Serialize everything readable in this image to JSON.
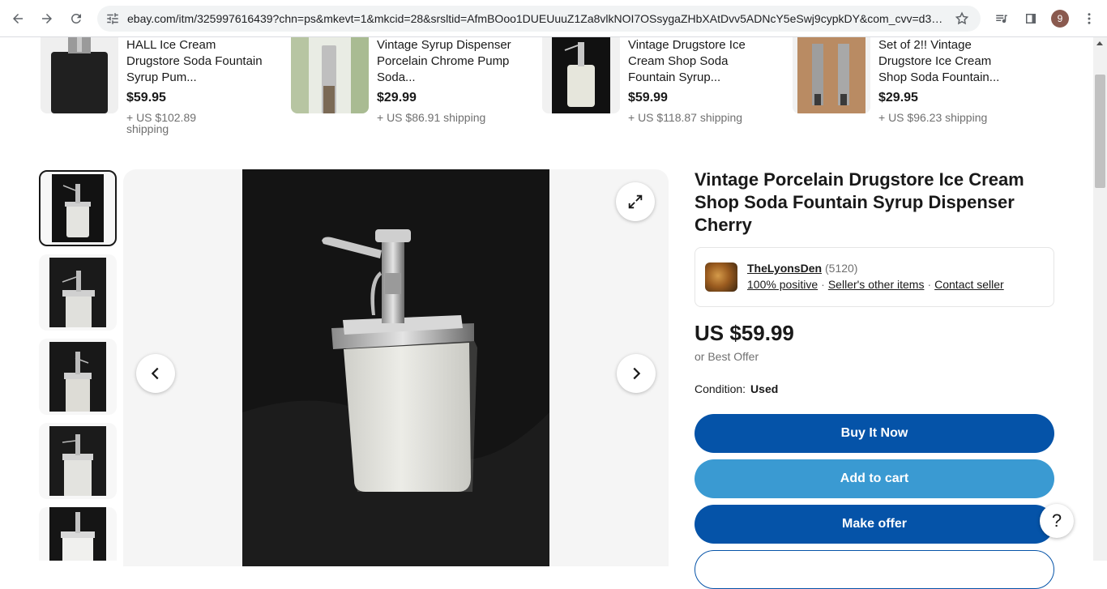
{
  "browser": {
    "url": "ebay.com/itm/325997616439?chn=ps&mkevt=1&mkcid=28&srsltid=AfmBOoo1DUEUuuZ1Za8vlkNOI7OSsygaZHbXAtDvv5ADNcY5eSwj9cypkDY&com_cvv=d300...",
    "profile_initial": "9",
    "icons": [
      "back-icon",
      "forward-icon",
      "reload-icon",
      "tune-icon",
      "star-icon",
      "media-control-icon",
      "side-panel-icon",
      "more-vert-icon"
    ]
  },
  "similar_items": [
    {
      "title": "HALL Ice Cream Drugstore Soda Fountain Syrup Pum...",
      "price": "$59.95",
      "shipping": "+ US $102.89 shipping"
    },
    {
      "title": "Vintage Syrup Dispenser Porcelain Chrome Pump Soda...",
      "price": "$29.99",
      "shipping": "+ US $86.91 shipping"
    },
    {
      "title": "Vintage Drugstore Ice Cream Shop Soda Fountain Syrup...",
      "price": "$59.99",
      "shipping": "+ US $118.87 shipping"
    },
    {
      "title": "Set of 2!! Vintage Drugstore Ice Cream Shop Soda Fountain...",
      "price": "$29.95",
      "shipping": "+ US $96.23 shipping"
    }
  ],
  "listing": {
    "title": "Vintage Porcelain Drugstore Ice Cream Shop Soda Fountain Syrup Dispenser Cherry",
    "seller": {
      "name": "TheLyonsDen",
      "feedback_count": "(5120)",
      "positive": "100% positive",
      "other_items": "Seller's other items",
      "contact": "Contact seller"
    },
    "price": "US $59.99",
    "best_offer": "or Best Offer",
    "condition_label": "Condition:",
    "condition_value": "Used",
    "buttons": {
      "buy_now": "Buy It Now",
      "add_to_cart": "Add to cart",
      "make_offer": "Make offer"
    }
  },
  "help_label": "?"
}
